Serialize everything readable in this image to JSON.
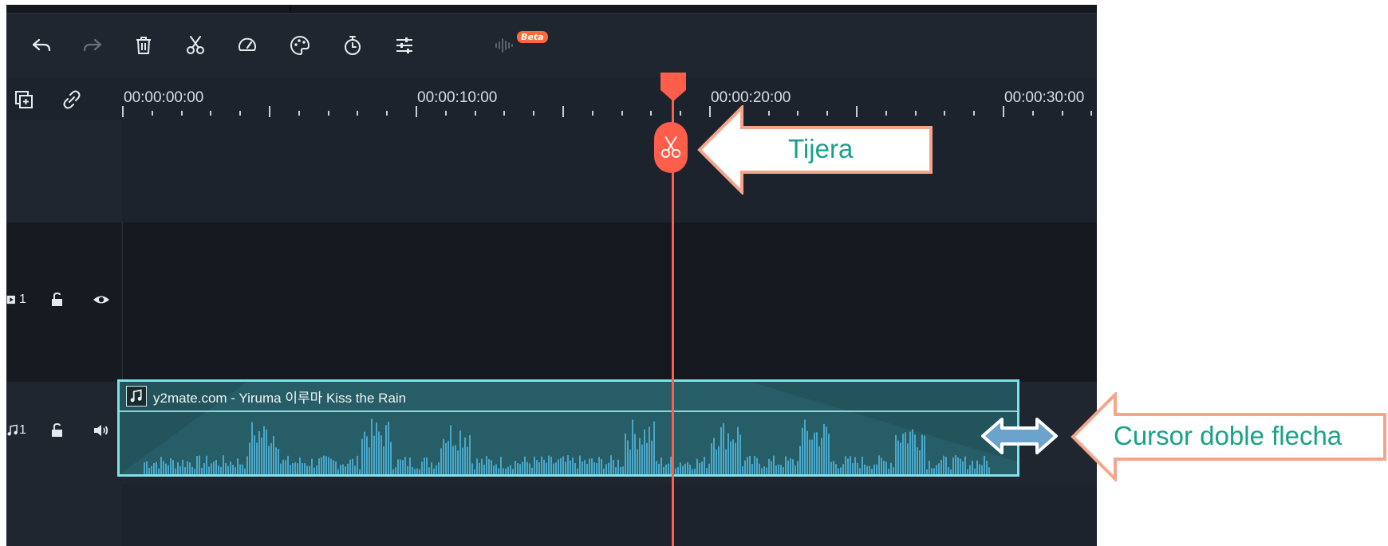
{
  "toolbar": {
    "items": [
      {
        "name": "undo",
        "icon": "undo-icon"
      },
      {
        "name": "redo",
        "icon": "redo-icon"
      },
      {
        "name": "delete",
        "icon": "trash-icon"
      },
      {
        "name": "split",
        "icon": "scissors-icon"
      },
      {
        "name": "speed",
        "icon": "speedometer-icon"
      },
      {
        "name": "color",
        "icon": "palette-icon"
      },
      {
        "name": "duration",
        "icon": "stopwatch-icon"
      },
      {
        "name": "adjust",
        "icon": "sliders-icon"
      },
      {
        "name": "audio-stretch",
        "icon": "waveform-icon"
      }
    ],
    "beta_label": "Beta"
  },
  "ruler": {
    "labels": [
      "00:00:00:00",
      "00:00:10:00",
      "00:00:20:00",
      "00:00:30:00"
    ]
  },
  "tracks": {
    "video": {
      "index": "1"
    },
    "audio": {
      "index": "1"
    }
  },
  "clip": {
    "title": "y2mate.com - Yiruma 이루마  Kiss the Rain"
  },
  "callouts": {
    "scissors": "Tijera",
    "cursor": "Cursor doble flecha"
  },
  "colors": {
    "playhead": "#ff5e4a",
    "clip_border": "#7fe2e6",
    "clip_fill": "#23545c",
    "callout_text": "#18a189",
    "callout_border": "#f4a58c",
    "double_arrow": "#6ba3cc"
  }
}
